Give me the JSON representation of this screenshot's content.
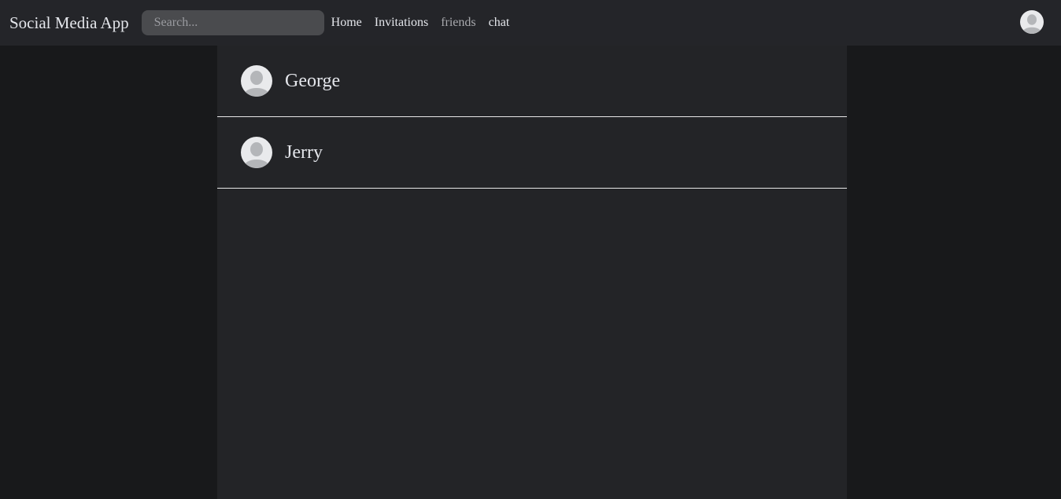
{
  "app": {
    "title": "Social Media App"
  },
  "search": {
    "placeholder": "Search..."
  },
  "nav": {
    "links": [
      {
        "label": "Home",
        "active": false
      },
      {
        "label": "Invitations",
        "active": false
      },
      {
        "label": "friends",
        "active": true
      },
      {
        "label": "chat",
        "active": false
      }
    ]
  },
  "user_avatar": {
    "icon": "user-avatar-icon"
  },
  "friends": [
    {
      "name": "George",
      "icon": "user-avatar-icon"
    },
    {
      "name": "Jerry",
      "icon": "user-avatar-icon"
    }
  ],
  "colors": {
    "navbar_bg": "#242529",
    "page_bg": "#18191b",
    "content_bg": "#232427",
    "text": "#e4e6eb",
    "active_link": "#a8a9ad",
    "divider": "#e8e8e8"
  }
}
